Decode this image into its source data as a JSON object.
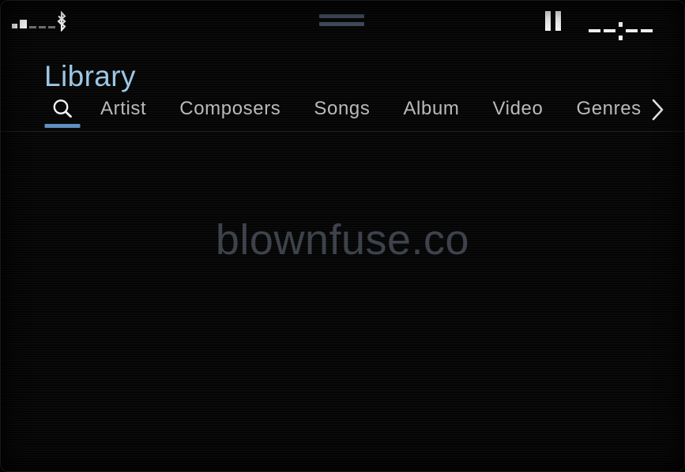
{
  "status_bar": {
    "signal_icon": "signal-strength-icon",
    "signal_bars_lit": 2,
    "signal_bars_dim": 3,
    "bluetooth_icon": "bluetooth-icon",
    "menu_icon": "menu-lines-icon",
    "playback_state_icon": "pause-icon",
    "clock": "--:--"
  },
  "header": {
    "title": "Library",
    "title_color": "#9cc6e4"
  },
  "tabs": {
    "active_index": 0,
    "accent_color": "#5d8fc0",
    "items": [
      {
        "label": "",
        "icon": "search-icon",
        "active": true
      },
      {
        "label": "Artist",
        "icon": "",
        "active": false
      },
      {
        "label": "Composers",
        "icon": "",
        "active": false
      },
      {
        "label": "Songs",
        "icon": "",
        "active": false
      },
      {
        "label": "Album",
        "icon": "",
        "active": false
      },
      {
        "label": "Video",
        "icon": "",
        "active": false
      },
      {
        "label": "Genres",
        "icon": "",
        "active": false
      }
    ],
    "next_icon": "chevron-right-icon"
  },
  "content": {
    "watermark": "blownfuse.co"
  }
}
